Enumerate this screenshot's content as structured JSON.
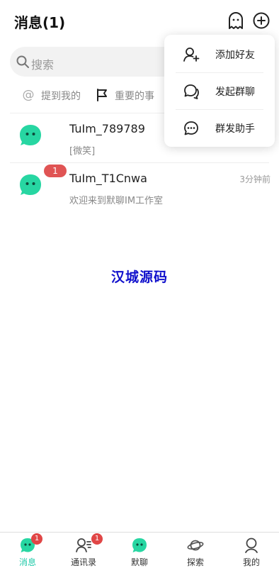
{
  "header": {
    "title": "消息(1)"
  },
  "search": {
    "placeholder": "搜索"
  },
  "filters": [
    {
      "label": "提到我的",
      "icon": "at-icon"
    },
    {
      "label": "重要的事",
      "icon": "flag-icon"
    }
  ],
  "conversations": [
    {
      "name": "TuIm_789789",
      "preview": "[微笑]",
      "time": "",
      "badge": ""
    },
    {
      "name": "TuIm_T1Cnwa",
      "preview": "欢迎来到默聊IM工作室",
      "time": "3分钟前",
      "badge": "1"
    }
  ],
  "watermark": "汉城源码",
  "menu": {
    "items": [
      {
        "label": "添加好友",
        "icon": "add-friend-icon"
      },
      {
        "label": "发起群聊",
        "icon": "group-chat-icon"
      },
      {
        "label": "群发助手",
        "icon": "broadcast-icon"
      }
    ]
  },
  "tabbar": {
    "items": [
      {
        "label": "消息",
        "icon": "message-icon",
        "badge": "1",
        "active": true
      },
      {
        "label": "通讯录",
        "icon": "contacts-icon",
        "badge": "1",
        "active": false
      },
      {
        "label": "默聊",
        "icon": "mochat-icon",
        "badge": "",
        "active": false
      },
      {
        "label": "探索",
        "icon": "planet-icon",
        "badge": "",
        "active": false
      },
      {
        "label": "我的",
        "icon": "profile-icon",
        "badge": "",
        "active": false
      }
    ]
  },
  "colors": {
    "accent": "#1fc9a8",
    "badge": "#e05454",
    "watermark": "#1010cc"
  }
}
